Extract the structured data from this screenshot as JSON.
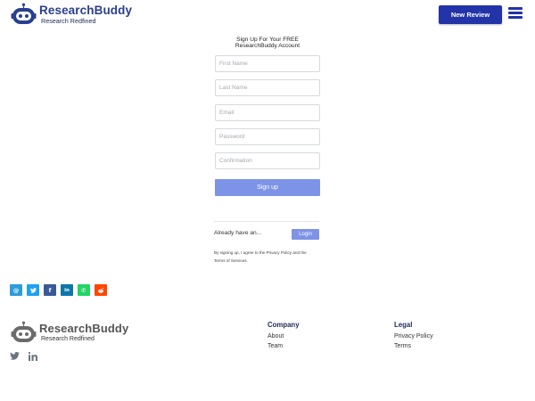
{
  "header": {
    "brand_title": "ResearchBuddy",
    "brand_subtitle": "Research Redfined",
    "new_review_label": "New Review",
    "menu_icon": "hamburger-menu-icon"
  },
  "signup": {
    "title_line1": "Sign Up For Your FREE",
    "title_line2": "ResearchBuddy Account",
    "first_name_placeholder": "First Name",
    "last_name_placeholder": "Last Name",
    "email_placeholder": "Email",
    "password_placeholder": "Password",
    "confirmation_placeholder": "Confirmation",
    "signup_label": "Sign up",
    "already_text": "Already have an...",
    "login_label": "Login",
    "terms_line1": "By signing up, I agree to the Privacy Policy and the",
    "terms_line2": "Terms of Services."
  },
  "share": {
    "buttons": [
      {
        "icon": "email-icon",
        "glyph": "@",
        "color": "#2d9cdb"
      },
      {
        "icon": "twitter-icon",
        "glyph": "🐦",
        "color": "#1da1f2"
      },
      {
        "icon": "facebook-icon",
        "glyph": "f",
        "color": "#3b5998"
      },
      {
        "icon": "linkedin-icon",
        "glyph": "in",
        "color": "#0e76a8"
      },
      {
        "icon": "whatsapp-icon",
        "glyph": "✆",
        "color": "#25d366"
      },
      {
        "icon": "reddit-icon",
        "glyph": "●",
        "color": "#ff4500"
      }
    ]
  },
  "footer": {
    "brand_title": "ResearchBuddy",
    "brand_subtitle": "Research Redfined",
    "company_heading": "Company",
    "company_links": [
      "About",
      "Team"
    ],
    "legal_heading": "Legal",
    "legal_links": [
      "Privacy Policy",
      "Terms"
    ],
    "social_icons": [
      "twitter-icon",
      "linkedin-icon"
    ]
  },
  "colors": {
    "brand": "#2a3f8e",
    "primary_button": "#2333a8",
    "light_button": "#7d93e6"
  }
}
